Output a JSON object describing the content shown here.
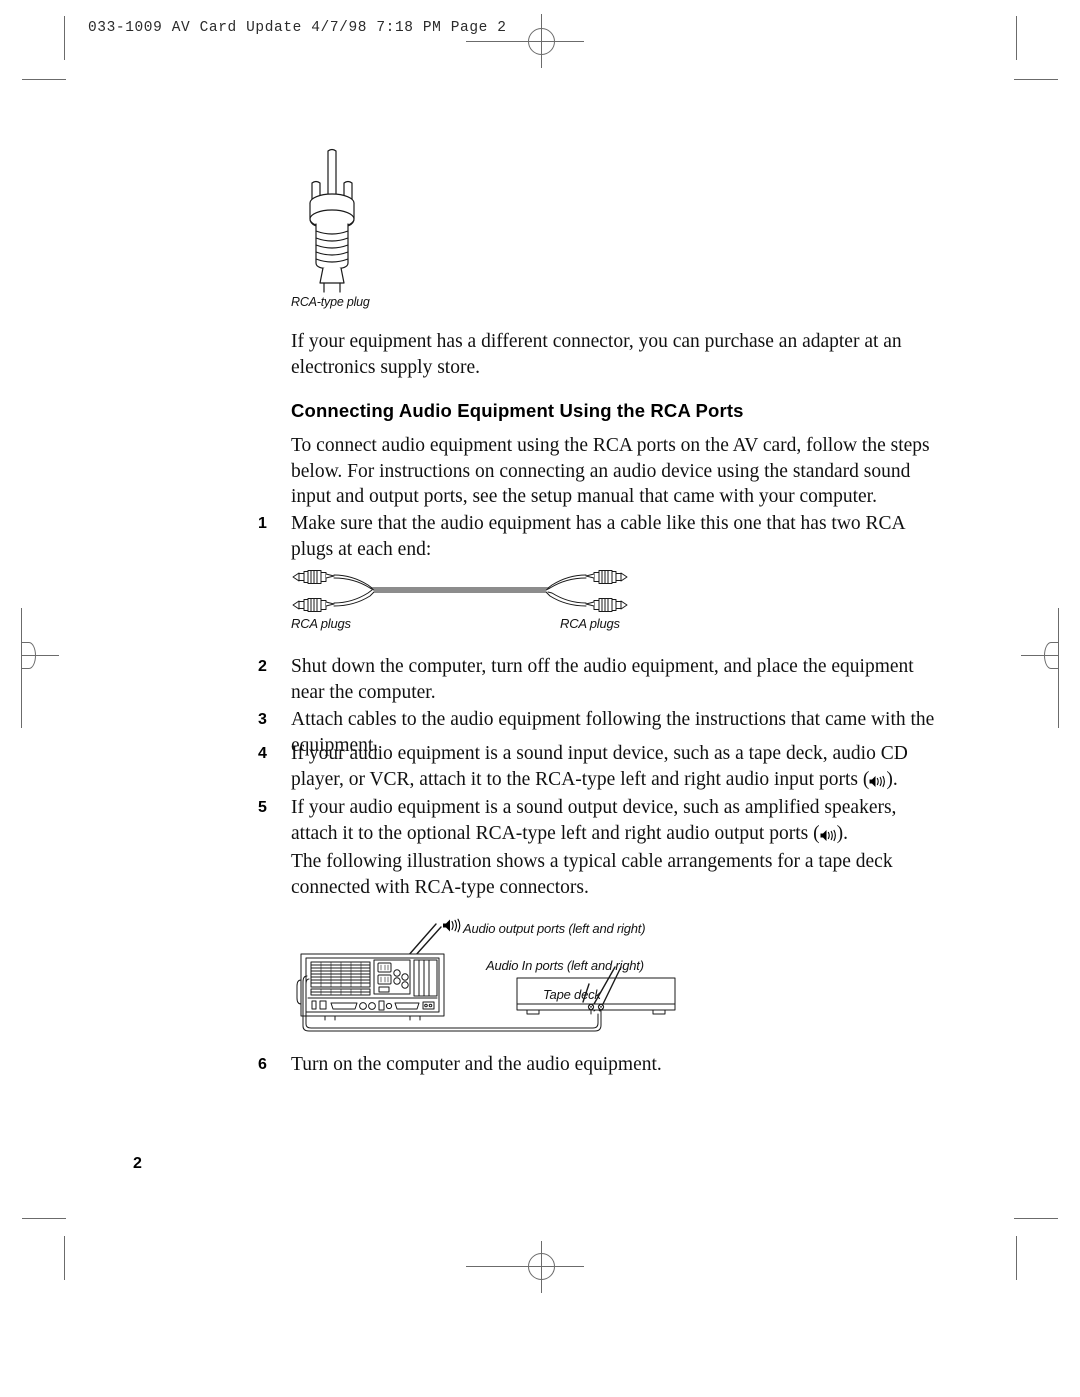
{
  "document": {
    "slug": "033-1009 AV Card Update  4/7/98 7:18 PM  Page 2",
    "folio": "2"
  },
  "figures": {
    "rca_plug": {
      "caption": "RCA-type plug"
    },
    "rca_cable": {
      "caption_left": "RCA plugs",
      "caption_right": "RCA plugs"
    },
    "tape_deck_setup": {
      "label_output_ports": "Audio output ports (left and right)",
      "label_input_ports": "Audio In ports (left and right)",
      "label_device": "Tape deck",
      "speaker_icon": "speaker-icon"
    }
  },
  "content": {
    "intro_paragraph": "If your equipment has a different connector, you can purchase an adapter at an electronics supply store.",
    "section_heading": "Connecting Audio Equipment Using the RCA Ports",
    "section_intro": "To connect audio equipment using the RCA ports on the AV card, follow the steps below. For instructions on connecting an audio device using the standard sound input and output ports, see the setup manual that came with your computer.",
    "steps": [
      {
        "number": "1",
        "text": "Make sure that the audio equipment has a cable like this one that has two RCA plugs at each end:"
      },
      {
        "number": "2",
        "text": "Shut down the computer, turn off the audio equipment, and place the equipment near the computer."
      },
      {
        "number": "3",
        "text": "Attach cables to the audio equipment following the instructions that came with the equipment."
      },
      {
        "number": "4",
        "text_before": "If your audio equipment is a sound input device, such as a tape deck, audio CD player, or VCR, attach it to the RCA-type left and right audio input ports (",
        "text_after": ")."
      },
      {
        "number": "5",
        "text_before": "If your audio equipment is a sound output device, such as amplified speakers, attach it to the optional RCA-type left and right audio output ports (",
        "text_after": ")."
      },
      {
        "number": "6",
        "text": "Turn on the computer and the audio equipment."
      }
    ],
    "illustration_lead": "The following illustration shows a typical cable arrangements for a tape deck connected with RCA-type connectors."
  },
  "colors": {
    "ink": "#111111",
    "mark": "#6b6b6b",
    "line_art": "#1a1a1a"
  }
}
